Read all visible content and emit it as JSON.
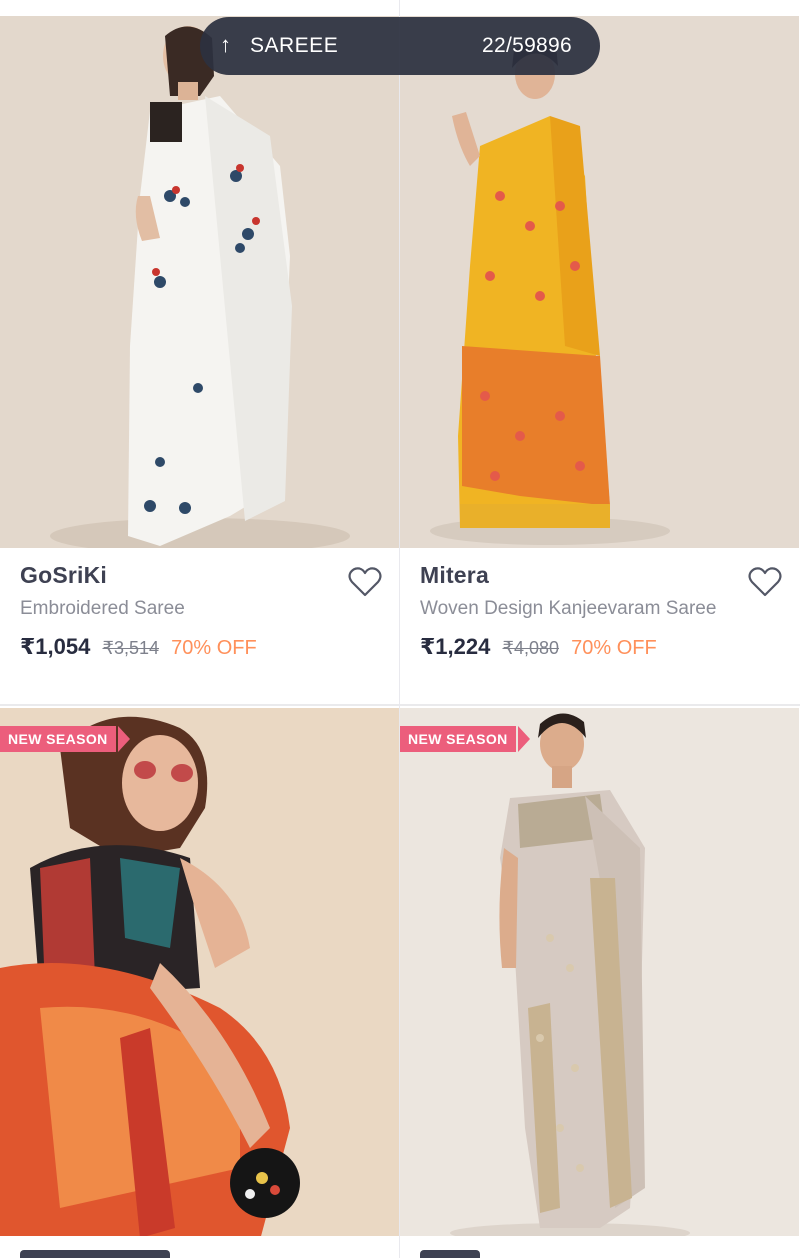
{
  "search_pill": {
    "arrow_icon": "arrow-up-icon",
    "query": "SAREEE",
    "position": "22/59896"
  },
  "products": [
    {
      "brand": "GoSriKi",
      "description": "Embroidered Saree",
      "price": "₹1,054",
      "mrp": "₹3,514",
      "discount": "70% OFF",
      "wishlist_icon": "heart-outline-icon"
    },
    {
      "brand": "Mitera",
      "description": "Woven Design Kanjeevaram Saree",
      "price": "₹1,224",
      "mrp": "₹4,080",
      "discount": "70% OFF",
      "wishlist_icon": "heart-outline-icon"
    },
    {
      "badge": "NEW SEASON"
    },
    {
      "badge": "NEW SEASON"
    }
  ],
  "colors": {
    "discount": "#ff905a",
    "badge": "#ec5e7c",
    "brand_text": "#3e4152",
    "pill_bg": "#2c3040"
  }
}
